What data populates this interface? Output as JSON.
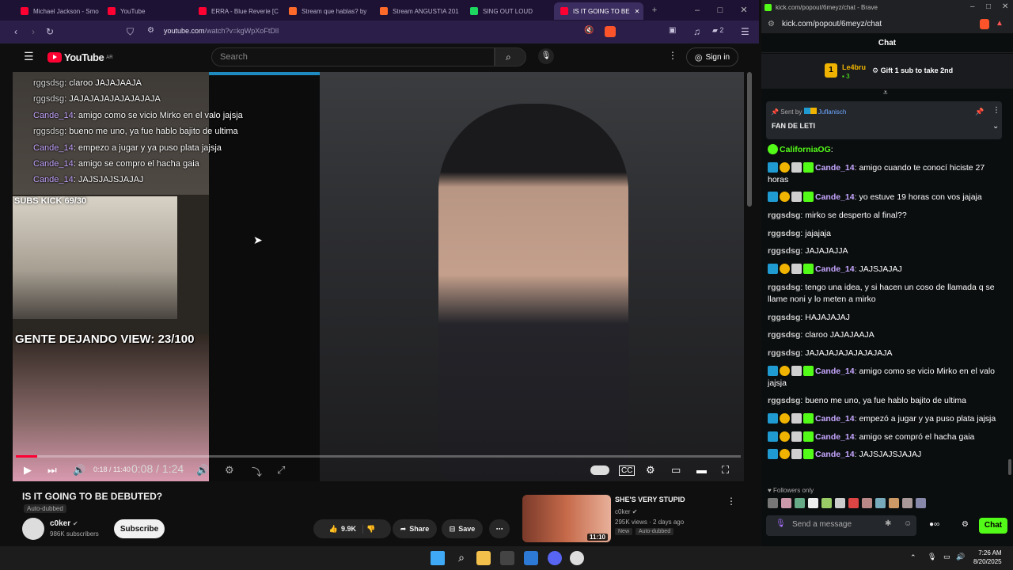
{
  "left_window": {
    "tabs": [
      {
        "title": "Michael Jackson - Smo",
        "color": "#ff0033"
      },
      {
        "title": "YouTube",
        "color": "#ff0033"
      },
      {
        "title": "ERRA - Blue Reverie [C",
        "color": "#ff0033"
      },
      {
        "title": "Stream que hablas? by",
        "color": "#ff6a2a"
      },
      {
        "title": "Stream ANGUSTIA 201",
        "color": "#ff6a2a"
      },
      {
        "title": "SING OUT LOUD",
        "color": "#1ed760"
      },
      {
        "title": "IS IT GOING TO BE",
        "color": "#ff0033",
        "active": true
      }
    ],
    "url_host": "youtube.com",
    "url_path": "/watch?v=kgWpXoFtDlI",
    "shield_count": "2"
  },
  "youtube": {
    "logo": "YouTube",
    "region": "AR",
    "search_placeholder": "Search",
    "signin_label": "Sign in",
    "video_title": "IS IT GOING TO BE DEBUTED?",
    "auto_dubbed": "Auto-dubbed",
    "channel_name": "c0ker",
    "channel_subs": "986K subscribers",
    "subscribe_label": "Subscribe",
    "like_count": "9.9K",
    "share_label": "Share",
    "save_label": "Save",
    "player": {
      "time_small": "0:18 / 11:40",
      "time_main": "0:08 / 1:24",
      "progress_fraction": 0.03
    },
    "overlay_chat": [
      {
        "user": "rggsdsg",
        "text": ": claroo JAJAJAAJA"
      },
      {
        "user": "rggsdsg",
        "text": ": JAJAJAJAJAJAJAJAJA"
      },
      {
        "user": "Cande_14",
        "text": ": amigo como se vicio Mirko en el valo jajsja"
      },
      {
        "user": "rggsdsg",
        "text": ": bueno me uno, ya fue hablo bajito de ultima"
      },
      {
        "user": "Cande_14",
        "text": ": empezo a jugar y ya puso plata jajsja"
      },
      {
        "user": "Cande_14",
        "text": ": amigo se compro el hacha gaia"
      },
      {
        "user": "Cande_14",
        "text": ": JAJSJAJSJAJAJ"
      }
    ],
    "overlay_subs": "SUBS KICK 69/30",
    "overlay_gente": "GENTE DEJANDO VIEW: 23/100",
    "recommended": {
      "title": "SHE'S VERY STUPID",
      "channel": "c0ker",
      "meta": "295K views · 2 days ago",
      "badge_new": "New",
      "badge_dub": "Auto-dubbed",
      "duration": "11:10"
    }
  },
  "right_window": {
    "title": "kick.com/popout/6meyz/chat - Brave",
    "url": "kick.com/popout/6meyz/chat",
    "chat_header": "Chat",
    "gift_leader": "Le4bru",
    "gift_count": "3",
    "gift_cta": "Gift 1 sub to take 2nd",
    "pinned_sender_label": "Sent by",
    "pinned_sender": "Juflanisch",
    "pinned_text": "FAN DE LETI",
    "messages": [
      {
        "user": "CaliforniaOG",
        "text": "",
        "color": "#53fc18"
      },
      {
        "user": "Cande_14",
        "text": "amigo cuando te conocí hiciste 27 horas",
        "color": "#c6a7ff",
        "badges": true
      },
      {
        "user": "Cande_14",
        "text": "yo estuve 19 horas con vos jajaja",
        "color": "#c6a7ff",
        "badges": true
      },
      {
        "user": "rggsdsg",
        "text": "mirko se desperto al final??",
        "color": "#c8c8c8"
      },
      {
        "user": "rggsdsg",
        "text": "jajajaja",
        "color": "#c8c8c8"
      },
      {
        "user": "rggsdsg",
        "text": "JAJAJAJJA",
        "color": "#c8c8c8"
      },
      {
        "user": "Cande_14",
        "text": "JAJSJAJAJ",
        "color": "#c6a7ff",
        "badges": true
      },
      {
        "user": "rggsdsg",
        "text": "tengo una idea, y si hacen un coso de llamada q se llame noni y lo meten a mirko",
        "color": "#c8c8c8"
      },
      {
        "user": "rggsdsg",
        "text": "HAJAJAJAJ",
        "color": "#c8c8c8"
      },
      {
        "user": "rggsdsg",
        "text": "claroo JAJAJAAJA",
        "color": "#c8c8c8"
      },
      {
        "user": "rggsdsg",
        "text": "JAJAJAJAJAJAJAJAJA",
        "color": "#c8c8c8"
      },
      {
        "user": "Cande_14",
        "text": "amigo como se vicio Mirko en el valo jajsja",
        "color": "#c6a7ff",
        "badges": true
      },
      {
        "user": "rggsdsg",
        "text": "bueno me uno, ya fue hablo bajito de ultima",
        "color": "#c8c8c8"
      },
      {
        "user": "Cande_14",
        "text": "empezó a jugar y ya puso plata jajsja",
        "color": "#c6a7ff",
        "badges": true
      },
      {
        "user": "Cande_14",
        "text": "amigo se compró el hacha gaia",
        "color": "#c6a7ff",
        "badges": true
      },
      {
        "user": "Cande_14",
        "text": "JAJSJAJSJAJAJ",
        "color": "#c6a7ff",
        "badges": true
      }
    ],
    "followers_only": "Followers only",
    "send_placeholder": "Send a message",
    "chat_button": "Chat"
  },
  "taskbar": {
    "time": "7:26 AM",
    "date": "8/20/2025"
  },
  "colors": {
    "kick_green": "#53fc18",
    "yt_red": "#ff0033",
    "brave_purple": "#2b1f49"
  }
}
